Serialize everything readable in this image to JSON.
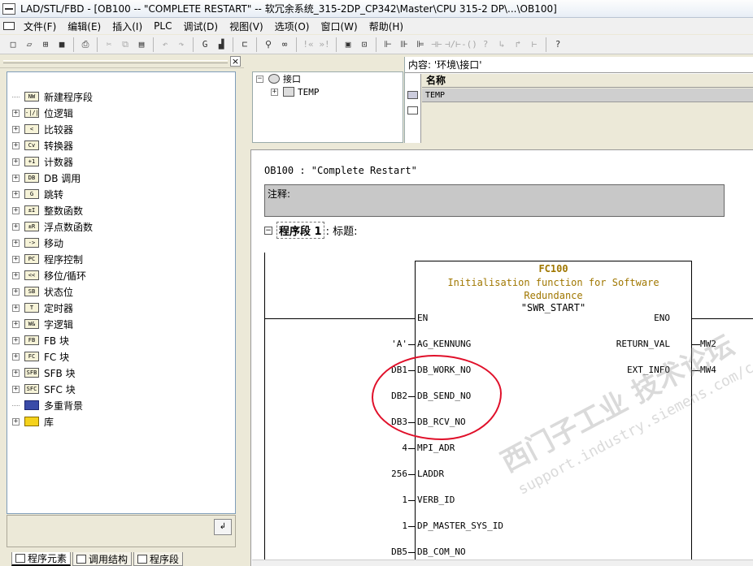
{
  "window": {
    "title": "LAD/STL/FBD  - [OB100 -- \"COMPLETE RESTART\" -- 软冗余系统_315-2DP_CP342\\Master\\CPU 315-2 DP\\...\\OB100]"
  },
  "menu": [
    "文件(F)",
    "编辑(E)",
    "插入(I)",
    "PLC",
    "调试(D)",
    "视图(V)",
    "选项(O)",
    "窗口(W)",
    "帮助(H)"
  ],
  "toolbar": {
    "buttons": [
      "new-icon",
      "open-icon",
      "network-icon",
      "save-icon",
      "print-icon",
      "cut-icon",
      "copy-icon",
      "paste-icon",
      "undo-icon",
      "redo-icon",
      "online-icon",
      "monitor-icon",
      "insert-network-icon",
      "glasses-icon",
      "zoom-icon",
      "prev-icon",
      "next-icon",
      "view-icon",
      "detail-icon",
      "contact-icon",
      "coil-icon",
      "branch-icon",
      "help-icon"
    ]
  },
  "program_elements": {
    "items": [
      {
        "label": "新建程序段",
        "icon": "new-network-icon",
        "expandable": false,
        "icon_text": "NW"
      },
      {
        "label": "位逻辑",
        "icon": "bit-logic-icon",
        "expandable": true,
        "icon_text": "-|/|-"
      },
      {
        "label": "比较器",
        "icon": "comparator-icon",
        "expandable": true,
        "icon_text": "<"
      },
      {
        "label": "转换器",
        "icon": "converter-icon",
        "expandable": true,
        "icon_text": "Cv"
      },
      {
        "label": "计数器",
        "icon": "counter-icon",
        "expandable": true,
        "icon_text": "+1"
      },
      {
        "label": "DB 调用",
        "icon": "db-call-icon",
        "expandable": true,
        "icon_text": "DB"
      },
      {
        "label": "跳转",
        "icon": "jump-icon",
        "expandable": true,
        "icon_text": "G"
      },
      {
        "label": "整数函数",
        "icon": "integer-icon",
        "expandable": true,
        "icon_text": "±I"
      },
      {
        "label": "浮点数函数",
        "icon": "float-icon",
        "expandable": true,
        "icon_text": "±R"
      },
      {
        "label": "移动",
        "icon": "move-icon",
        "expandable": true,
        "icon_text": "->"
      },
      {
        "label": "程序控制",
        "icon": "program-control-icon",
        "expandable": true,
        "icon_text": "PC"
      },
      {
        "label": "移位/循环",
        "icon": "shift-icon",
        "expandable": true,
        "icon_text": "<<"
      },
      {
        "label": "状态位",
        "icon": "status-bit-icon",
        "expandable": true,
        "icon_text": "SB"
      },
      {
        "label": "定时器",
        "icon": "timer-icon",
        "expandable": true,
        "icon_text": "T"
      },
      {
        "label": "字逻辑",
        "icon": "word-logic-icon",
        "expandable": true,
        "icon_text": "W&"
      },
      {
        "label": "FB 块",
        "icon": "fb-block-icon",
        "expandable": true,
        "icon_text": "FB"
      },
      {
        "label": "FC 块",
        "icon": "fc-block-icon",
        "expandable": true,
        "icon_text": "FC"
      },
      {
        "label": "SFB 块",
        "icon": "sfb-block-icon",
        "expandable": true,
        "icon_text": "SFB"
      },
      {
        "label": "SFC 块",
        "icon": "sfc-block-icon",
        "expandable": true,
        "icon_text": "SFC"
      },
      {
        "label": "多重背景",
        "icon": "multi-instance-icon",
        "expandable": false,
        "icon_text": ""
      },
      {
        "label": "库",
        "icon": "library-icon",
        "expandable": true,
        "icon_text": ""
      }
    ]
  },
  "bottom_tabs": [
    "程序元素",
    "调用结构",
    "程序段"
  ],
  "interface": {
    "tree_root": "接口",
    "tree_child": "TEMP",
    "content_label": "内容: '环境\\接口'",
    "column_name": "名称",
    "rows": [
      "TEMP"
    ]
  },
  "editor": {
    "block_line": "OB100 :  \"Complete Restart\"",
    "comment_label": "注释:",
    "network_label": "程序段 1",
    "network_title": ": 标题:",
    "fb": {
      "name": "FC100",
      "desc1": "Initialisation function for Software",
      "desc2": "Redundance",
      "symbol": "\"SWR_START\""
    },
    "inputs": [
      {
        "pin": "EN",
        "actual": ""
      },
      {
        "pin": "AG_KENNUNG",
        "actual": "'A'"
      },
      {
        "pin": "DB_WORK_NO",
        "actual": "DB1"
      },
      {
        "pin": "DB_SEND_NO",
        "actual": "DB2"
      },
      {
        "pin": "DB_RCV_NO",
        "actual": "DB3"
      },
      {
        "pin": "MPI_ADR",
        "actual": "4"
      },
      {
        "pin": "LADDR",
        "actual": "256"
      },
      {
        "pin": "VERB_ID",
        "actual": "1"
      },
      {
        "pin": "DP_MASTER_SYS_ID",
        "actual": "1"
      },
      {
        "pin": "DB_COM_NO",
        "actual": "DB5"
      }
    ],
    "outputs": [
      {
        "pin": "ENO",
        "actual": ""
      },
      {
        "pin": "RETURN_VAL",
        "actual": "MW2"
      },
      {
        "pin": "EXT_INFO",
        "actual": "MW4"
      }
    ],
    "watermark_1": "西门子工业  技术论坛",
    "watermark_2": "support.industry.siemens.com/cs"
  }
}
